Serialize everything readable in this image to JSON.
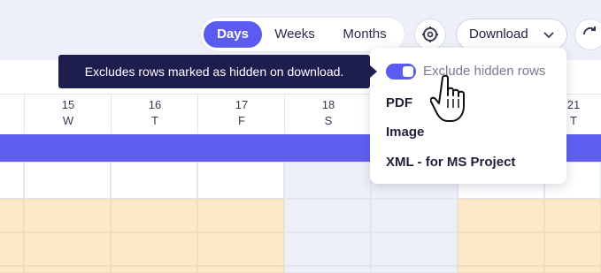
{
  "toolbar": {
    "views": [
      {
        "label": "Days",
        "active": true
      },
      {
        "label": "Weeks",
        "active": false
      },
      {
        "label": "Months",
        "active": false
      }
    ],
    "download_label": "Download"
  },
  "timeline": {
    "dates": [
      {
        "num": "15",
        "day": "W"
      },
      {
        "num": "16",
        "day": "T"
      },
      {
        "num": "17",
        "day": "F"
      },
      {
        "num": "18",
        "day": "S"
      },
      {
        "num": "21",
        "day": "T"
      }
    ]
  },
  "tooltip": {
    "text": "Excludes rows marked as hidden on download."
  },
  "download_menu": {
    "toggle_label": "Exclude hidden rows",
    "toggle_on": true,
    "items": [
      "PDF",
      "Image",
      "XML - for MS Project"
    ]
  },
  "colors": {
    "accent": "#5b5bf0",
    "bar": "#5f5ff2",
    "tooltip_bg": "#1d1d4e",
    "task_fill": "#fde9c8",
    "weekend_fill": "#eef0f8"
  }
}
